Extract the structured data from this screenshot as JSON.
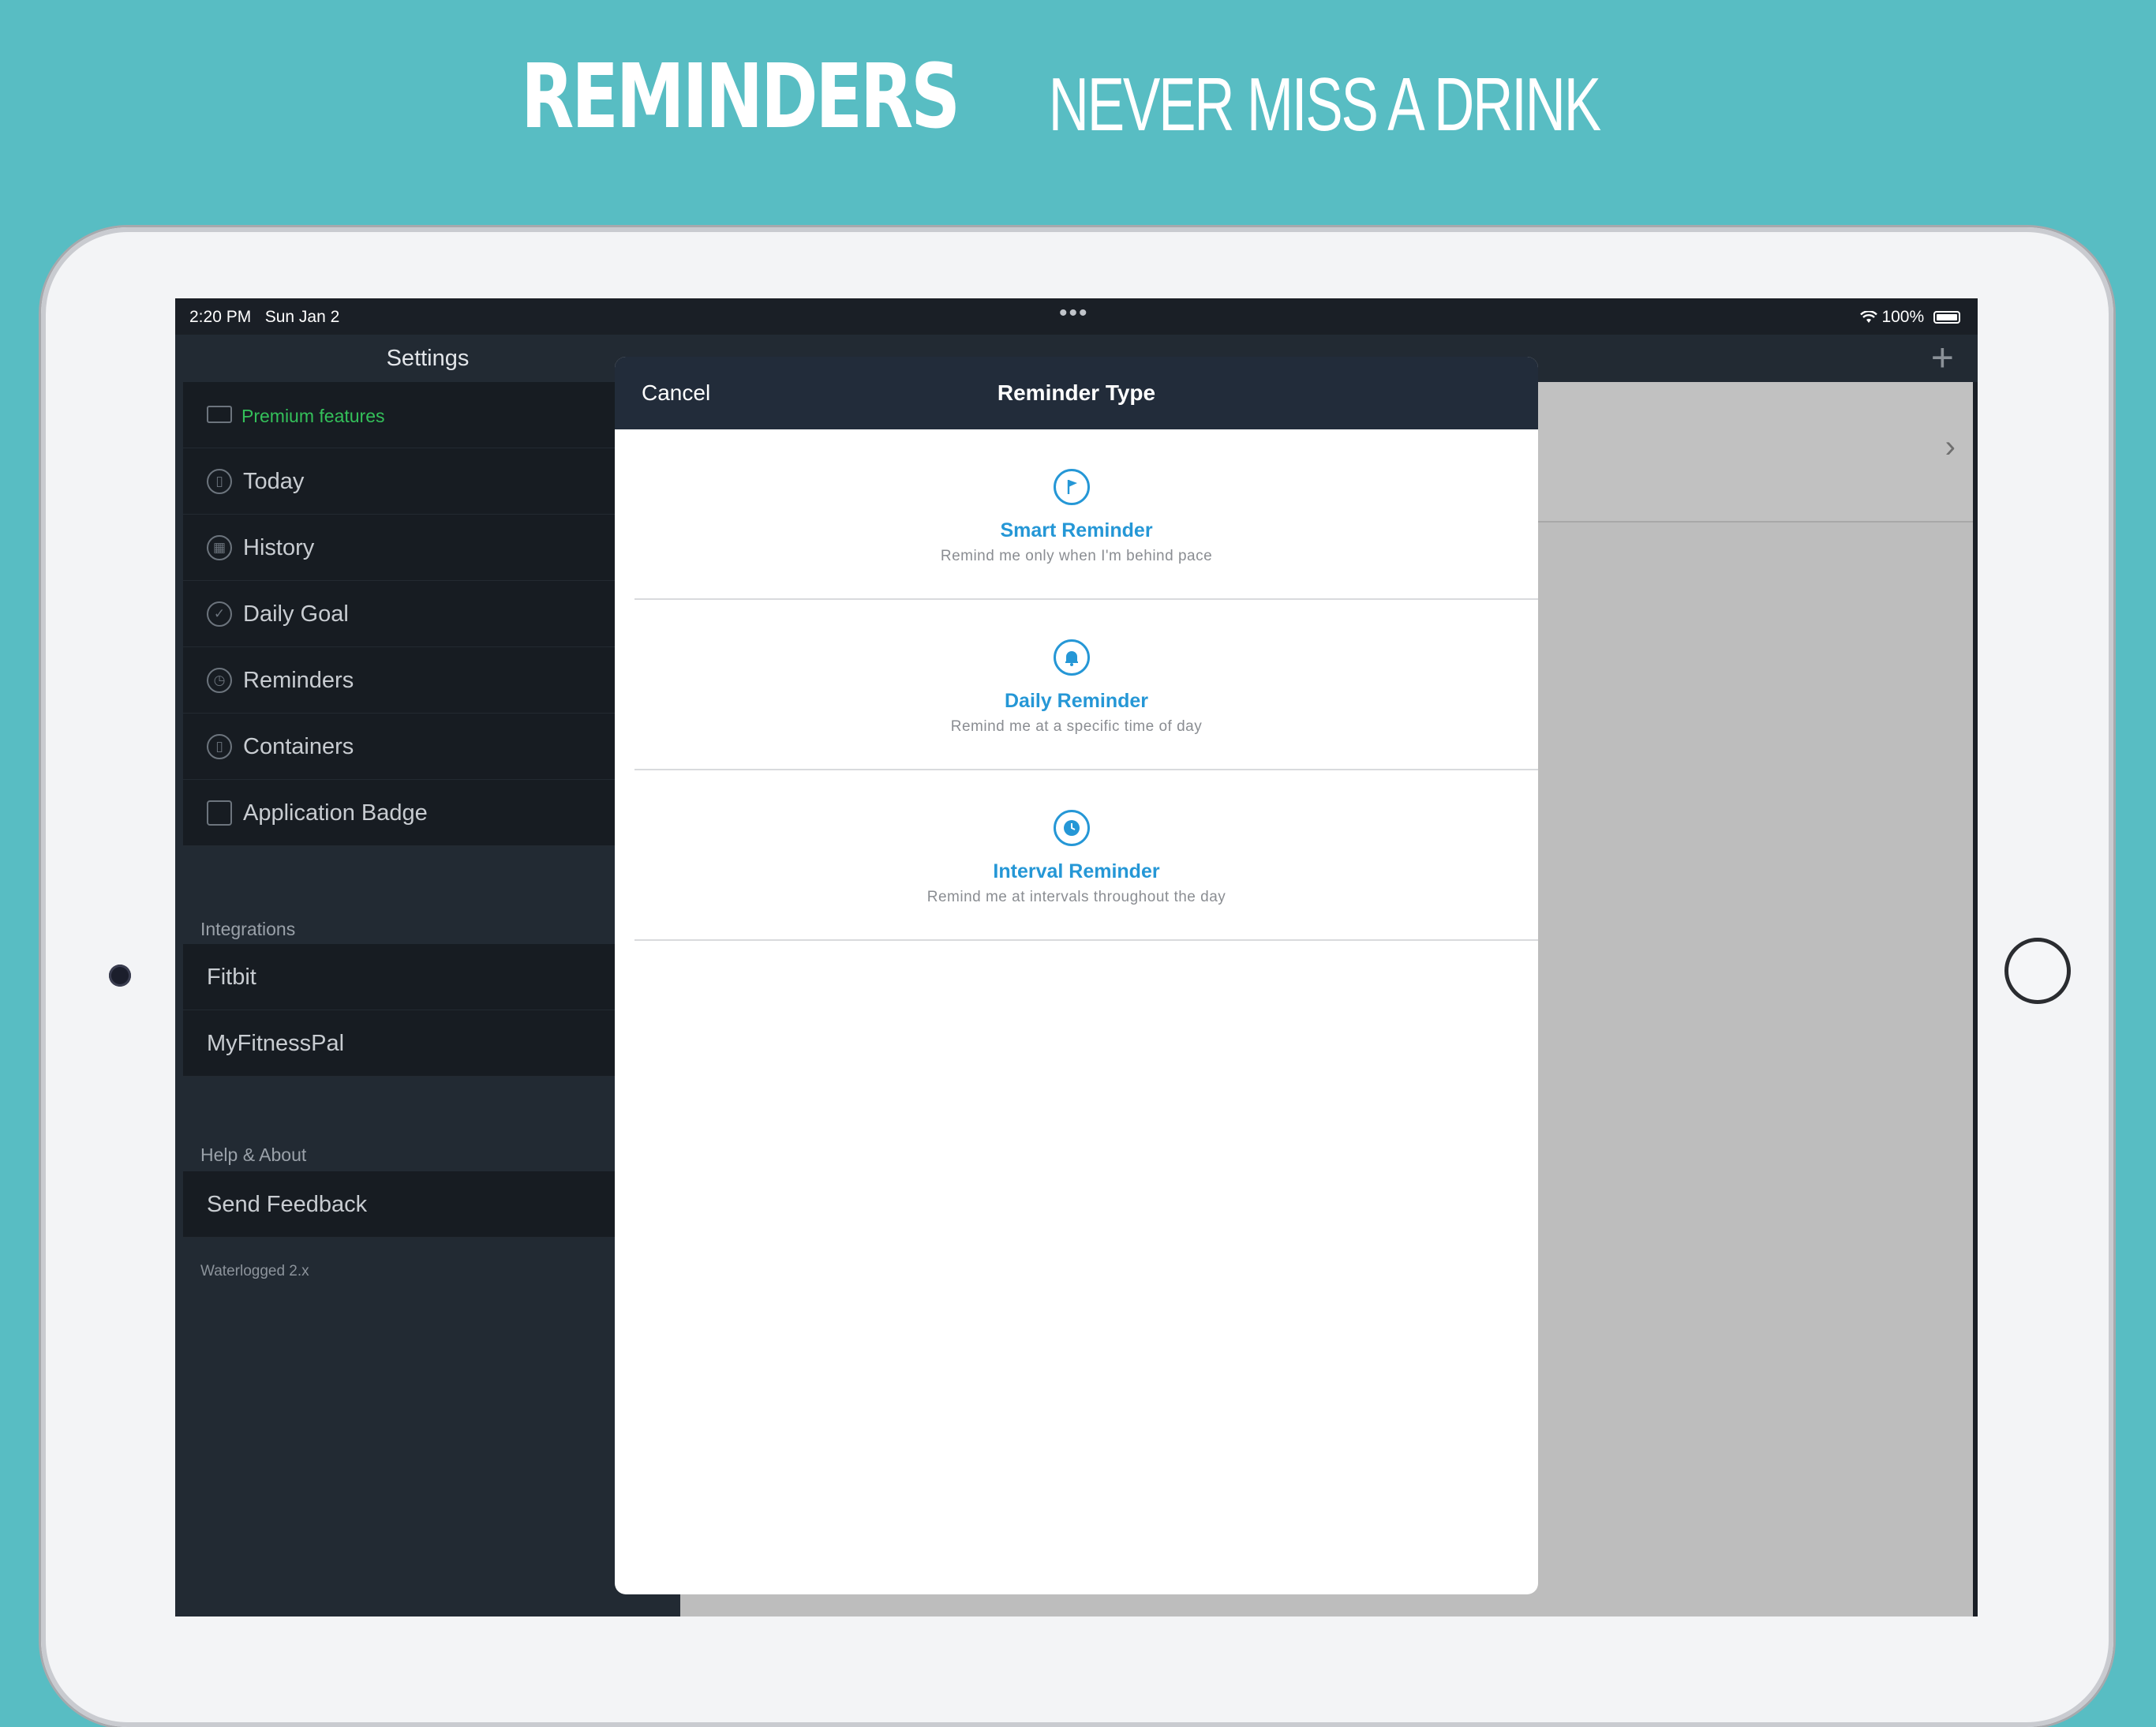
{
  "headline": {
    "bold": "REMINDERS",
    "light": "NEVER MISS A DRINK"
  },
  "colors": {
    "background": "#58bdc3",
    "accent": "#2597d6",
    "premium": "#34c05a",
    "sidebar": "#171c22"
  },
  "status_bar": {
    "time": "2:20 PM",
    "date": "Sun Jan 2",
    "battery": "100%",
    "wifi_icon": "wifi-icon",
    "dots": "•••"
  },
  "sidebar": {
    "title": "Settings",
    "items": [
      {
        "label": "Premium features",
        "icon": "card-icon"
      },
      {
        "label": "Today",
        "icon": "bottle-icon"
      },
      {
        "label": "History",
        "icon": "calendar-icon"
      },
      {
        "label": "Daily Goal",
        "icon": "check-icon"
      },
      {
        "label": "Reminders",
        "icon": "clock-icon"
      },
      {
        "label": "Containers",
        "icon": "bottle-icon"
      },
      {
        "label": "Application Badge",
        "icon": "badge-icon"
      }
    ],
    "integrations": {
      "header": "Integrations",
      "items": [
        "Fitbit",
        "MyFitnessPal"
      ]
    },
    "help": {
      "header": "Help & About",
      "items": [
        "Send Feedback"
      ]
    },
    "version": "Waterlogged 2.x"
  },
  "modal": {
    "cancel": "Cancel",
    "title": "Reminder Type",
    "options": [
      {
        "title": "Smart Reminder",
        "subtitle": "Remind me only when I'm behind pace",
        "icon": "flag-icon"
      },
      {
        "title": "Daily Reminder",
        "subtitle": "Remind me at a specific time of day",
        "icon": "bell-icon"
      },
      {
        "title": "Interval Reminder",
        "subtitle": "Remind me at intervals throughout the day",
        "icon": "clock-icon"
      }
    ]
  }
}
